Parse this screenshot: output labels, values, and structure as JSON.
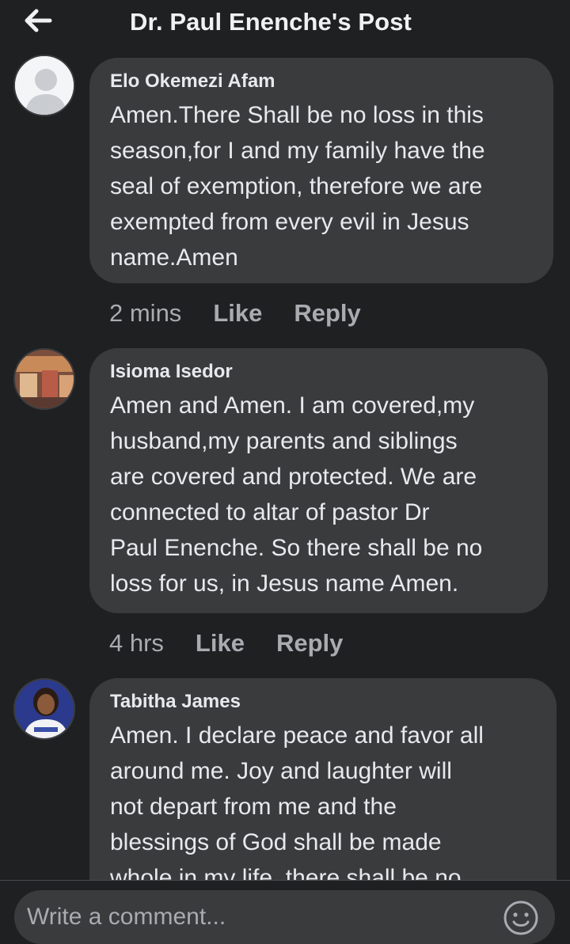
{
  "header": {
    "title": "Dr. Paul Enenche's Post",
    "back_icon": "arrow-left-icon"
  },
  "comments": [
    {
      "author": "Elo Okemezi Afam",
      "lines": [
        "Amen.There Shall be no loss in this",
        "season,for I and my family have the",
        "seal of exemption, therefore we are",
        "exempted from every evil in Jesus",
        "name.Amen"
      ],
      "time": "2 mins",
      "like_label": "Like",
      "reply_label": "Reply"
    },
    {
      "author": "Isioma Isedor",
      "lines": [
        "Amen and Amen.  I am covered,my",
        "husband,my parents and siblings",
        "are covered  and protected. We are",
        "connected  to altar of pastor Dr",
        "Paul Enenche.  So there shall be no",
        "loss for us, in Jesus name Amen."
      ],
      "time": "4 hrs",
      "like_label": "Like",
      "reply_label": "Reply"
    },
    {
      "author": "Tabitha James",
      "lines": [
        "Amen. I declare peace and favor all",
        "around me. Joy and laughter will",
        "not depart from me and the",
        "blessings of God shall be made",
        "whole in my life. there shall be no"
      ]
    }
  ],
  "composer": {
    "placeholder": "Write a comment...",
    "emoji_icon": "smiley-icon"
  },
  "colors": {
    "background": "#1f2022",
    "bubble": "#3a3b3d",
    "text": "#e8e9ec",
    "muted": "#a9abb0"
  }
}
